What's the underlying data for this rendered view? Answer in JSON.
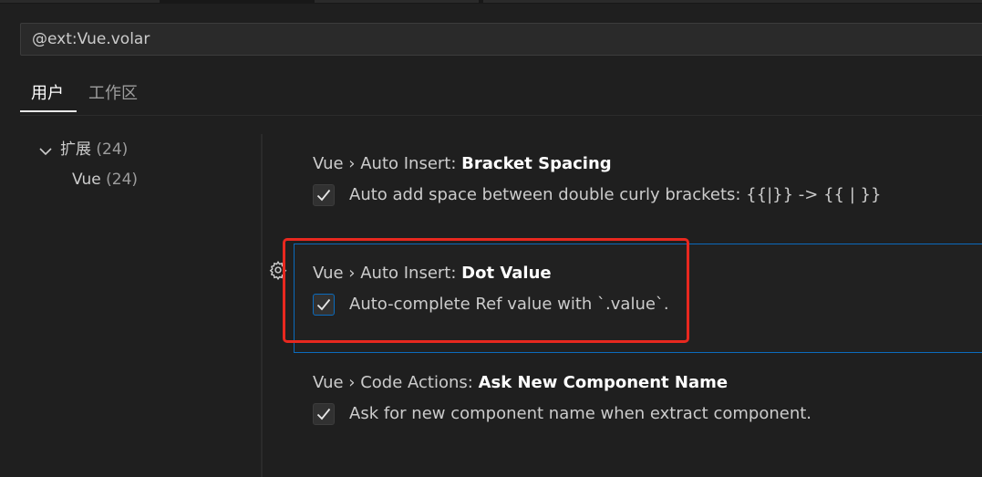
{
  "search": {
    "value": "@ext:Vue.volar"
  },
  "scope_tabs": [
    {
      "label": "用户",
      "active": true
    },
    {
      "label": "工作区",
      "active": false
    }
  ],
  "toc": {
    "group_label": "扩展",
    "group_count": "(24)",
    "child_label": "Vue",
    "child_count": "(24)"
  },
  "settings": [
    {
      "category": "Vue › Auto Insert: ",
      "name": "Bracket Spacing",
      "description": "Auto add space between double curly brackets: {{|}} -> {{ | }}",
      "checked": true
    },
    {
      "category": "Vue › Auto Insert: ",
      "name": "Dot Value",
      "description": "Auto-complete Ref value with `.value`.",
      "checked": true
    },
    {
      "category": "Vue › Code Actions: ",
      "name": "Ask New Component Name",
      "description": "Ask for new component name when extract component.",
      "checked": true
    }
  ],
  "icons": {
    "gear": "gear-icon",
    "chevron": "chevron-down-icon",
    "check": "check-icon"
  },
  "colors": {
    "background": "#1f1f1f",
    "focus_border": "#0b6bbd",
    "annotation": "#e8281f"
  }
}
